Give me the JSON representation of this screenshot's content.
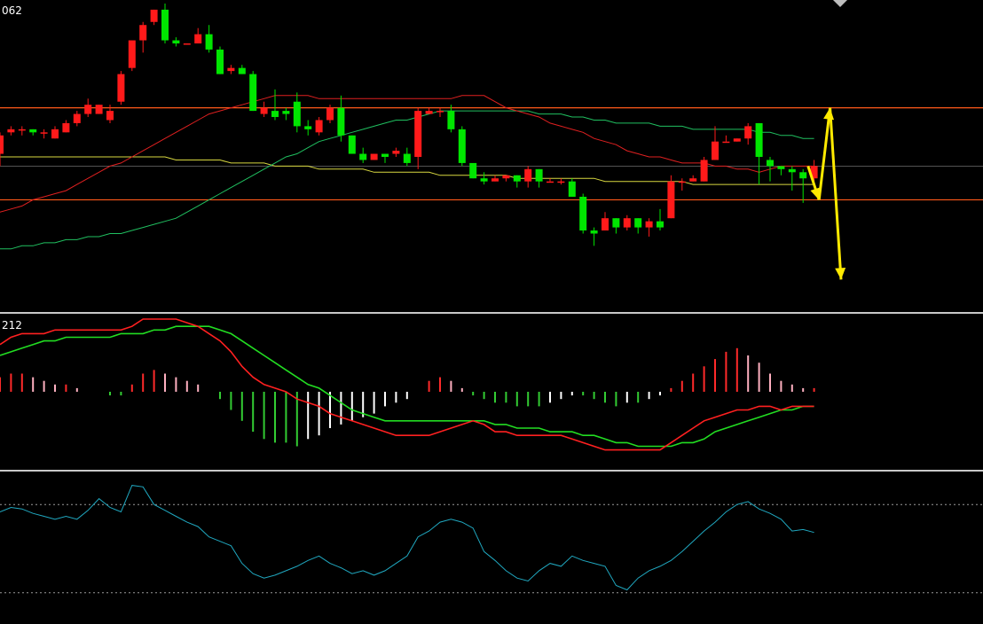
{
  "colors": {
    "background": "#000000",
    "bull": "#ff1a1a",
    "bear": "#00e600",
    "ma_fast": "#e02020",
    "ma_mid": "#20c060",
    "ma_slow": "#d8d840",
    "hline": "#ff5a1a",
    "arrow": "#ffea00",
    "separator": "#c8c8c8",
    "dif": "#ff2020",
    "dea": "#22dd22",
    "hist_pos_strong": "#ff2a2a",
    "hist_pos_weak": "#ffb0c0",
    "hist_neg_strong": "#33cc33",
    "hist_neg_weak": "#ffffff",
    "osc": "#20a8c0",
    "osc_level": "#9a9a9a"
  },
  "panels": {
    "price_label": "062",
    "macd_label": "212"
  },
  "chart_data": [
    {
      "type": "candlestick",
      "panel": "price",
      "ylim": [
        0,
        100
      ],
      "x": [
        0,
        1,
        2,
        3,
        4,
        5,
        6,
        7,
        8,
        9,
        10,
        11,
        12,
        13,
        14,
        15,
        16,
        17,
        18,
        19,
        20,
        21,
        22,
        23,
        24,
        25,
        26,
        27,
        28,
        29,
        30,
        31,
        32,
        33,
        34,
        35,
        36,
        37,
        38,
        39,
        40,
        41,
        42,
        43,
        44,
        45,
        46,
        47,
        48,
        49,
        50,
        51,
        52,
        53,
        54,
        55,
        56,
        57,
        58,
        59,
        60,
        61,
        62,
        63,
        64,
        65,
        66,
        67,
        68,
        69,
        70,
        71,
        72,
        73,
        74
      ],
      "ohlc": [
        [
          51,
          57,
          47,
          58
        ],
        [
          58,
          59,
          57,
          60
        ],
        [
          59,
          59,
          57,
          60
        ],
        [
          59,
          58,
          57,
          59
        ],
        [
          58,
          58,
          56,
          59
        ],
        [
          56,
          59,
          56,
          60
        ],
        [
          58,
          61,
          58,
          62
        ],
        [
          61,
          64,
          60,
          65
        ],
        [
          64,
          67,
          63,
          69
        ],
        [
          64,
          67,
          64,
          67
        ],
        [
          62,
          65,
          61,
          67
        ],
        [
          68,
          77,
          67,
          78
        ],
        [
          79,
          88,
          78,
          88
        ],
        [
          88,
          93,
          84,
          94
        ],
        [
          94,
          98,
          93,
          98
        ],
        [
          98,
          88,
          87,
          100
        ],
        [
          88,
          87,
          86,
          89
        ],
        [
          87,
          87,
          87,
          87
        ],
        [
          87,
          90,
          87,
          92
        ],
        [
          90,
          85,
          84,
          93
        ],
        [
          85,
          77,
          77,
          86
        ],
        [
          78,
          79,
          77,
          80
        ],
        [
          79,
          77,
          77,
          80
        ],
        [
          77,
          65,
          65,
          78
        ],
        [
          64,
          66,
          63,
          68
        ],
        [
          65,
          63,
          62,
          72
        ],
        [
          65,
          64,
          62,
          66
        ],
        [
          68,
          60,
          58,
          71
        ],
        [
          60,
          59,
          57,
          62
        ],
        [
          58,
          62,
          57,
          63
        ],
        [
          62,
          66,
          61,
          67
        ],
        [
          66,
          57,
          55,
          70
        ],
        [
          57,
          51,
          51,
          57
        ],
        [
          51,
          49,
          48,
          53
        ],
        [
          49,
          51,
          49,
          51
        ],
        [
          51,
          50,
          48,
          51
        ],
        [
          51,
          52,
          50,
          53
        ],
        [
          51,
          48,
          47,
          53
        ],
        [
          50,
          65,
          46,
          66
        ],
        [
          64,
          65,
          64,
          66
        ],
        [
          65,
          65,
          63,
          66
        ],
        [
          65,
          59,
          58,
          67
        ],
        [
          59,
          48,
          47,
          60
        ],
        [
          48,
          43,
          43,
          47
        ],
        [
          43,
          42,
          41,
          45
        ],
        [
          42,
          43,
          42,
          44
        ],
        [
          43,
          44,
          42,
          44
        ],
        [
          44,
          42,
          40,
          44
        ],
        [
          42,
          46,
          40,
          47
        ],
        [
          46,
          42,
          40,
          46
        ],
        [
          42,
          42,
          42,
          43
        ],
        [
          42,
          42,
          41,
          43
        ],
        [
          42,
          37,
          37,
          43
        ],
        [
          37,
          26,
          25,
          38
        ],
        [
          26,
          25,
          21,
          27
        ],
        [
          26,
          30,
          26,
          32
        ],
        [
          30,
          27,
          25,
          30
        ],
        [
          27,
          30,
          26,
          31
        ],
        [
          30,
          27,
          25,
          30
        ],
        [
          27,
          29,
          24,
          30
        ],
        [
          29,
          27,
          26,
          33
        ],
        [
          30,
          42,
          30,
          44
        ],
        [
          42,
          42,
          39,
          43
        ],
        [
          42,
          43,
          42,
          44
        ],
        [
          42,
          49,
          42,
          50
        ],
        [
          49,
          55,
          49,
          60
        ],
        [
          55,
          55,
          55,
          57
        ],
        [
          55,
          56,
          55,
          56
        ],
        [
          56,
          60,
          54,
          61
        ],
        [
          61,
          50,
          41,
          61
        ],
        [
          49,
          47,
          42,
          50
        ],
        [
          47,
          46,
          44,
          47
        ],
        [
          46,
          45,
          39,
          47
        ],
        [
          45,
          43,
          35,
          46
        ],
        [
          43,
          47,
          41,
          49
        ]
      ],
      "ma_fast": [
        32,
        33,
        34,
        36,
        37,
        38,
        39,
        41,
        43,
        45,
        47,
        48,
        50,
        52,
        54,
        56,
        58,
        60,
        62,
        64,
        65,
        66,
        67,
        68,
        69,
        70,
        70,
        70,
        70,
        69,
        69,
        69,
        69,
        69,
        69,
        69,
        69,
        69,
        69,
        69,
        69,
        69,
        70,
        70,
        70,
        68,
        66,
        65,
        64,
        63,
        61,
        60,
        59,
        58,
        56,
        55,
        54,
        52,
        51,
        50,
        50,
        49,
        48,
        48,
        48,
        47,
        47,
        46,
        46,
        45,
        46,
        47,
        47,
        47,
        47
      ],
      "ma_mid": [
        20,
        20,
        21,
        21,
        22,
        22,
        23,
        23,
        24,
        24,
        25,
        25,
        26,
        27,
        28,
        29,
        30,
        32,
        34,
        36,
        38,
        40,
        42,
        44,
        46,
        48,
        50,
        51,
        53,
        55,
        56,
        57,
        58,
        59,
        60,
        61,
        62,
        62,
        63,
        64,
        65,
        65,
        65,
        65,
        65,
        65,
        65,
        65,
        65,
        64,
        64,
        64,
        63,
        63,
        62,
        62,
        61,
        61,
        61,
        61,
        60,
        60,
        60,
        59,
        59,
        59,
        59,
        59,
        59,
        58,
        58,
        57,
        57,
        56,
        56
      ],
      "ma_slow": [
        50,
        50,
        50,
        50,
        50,
        50,
        50,
        50,
        50,
        50,
        50,
        50,
        50,
        50,
        50,
        50,
        49,
        49,
        49,
        49,
        49,
        48,
        48,
        48,
        48,
        47,
        47,
        47,
        47,
        46,
        46,
        46,
        46,
        46,
        45,
        45,
        45,
        45,
        45,
        45,
        44,
        44,
        44,
        44,
        44,
        44,
        44,
        43,
        43,
        43,
        43,
        43,
        43,
        43,
        43,
        42,
        42,
        42,
        42,
        42,
        42,
        42,
        42,
        41,
        41,
        41,
        41,
        41,
        41,
        41,
        41,
        41,
        41,
        41,
        41
      ],
      "hlines": [
        66,
        36,
        47
      ]
    },
    {
      "type": "macd",
      "panel": "macd",
      "ylim": [
        -20,
        20
      ],
      "dif": [
        13,
        15,
        16,
        16,
        16,
        17,
        17,
        17,
        17,
        17,
        17,
        17,
        18,
        20,
        20,
        20,
        20,
        19,
        18,
        16,
        14,
        11,
        7,
        4,
        2,
        1,
        0,
        -2,
        -3,
        -4,
        -6,
        -7,
        -8,
        -9,
        -10,
        -11,
        -12,
        -12,
        -12,
        -12,
        -11,
        -10,
        -9,
        -8,
        -9,
        -11,
        -11,
        -12,
        -12,
        -12,
        -12,
        -12,
        -13,
        -14,
        -15,
        -16,
        -16,
        -16,
        -16,
        -16,
        -16,
        -14,
        -12,
        -10,
        -8,
        -7,
        -6,
        -5,
        -5,
        -4,
        -4,
        -5,
        -4,
        -4,
        -4
      ],
      "dea": [
        10,
        11,
        12,
        13,
        14,
        14,
        15,
        15,
        15,
        15,
        15,
        16,
        16,
        16,
        17,
        17,
        18,
        18,
        18,
        18,
        17,
        16,
        14,
        12,
        10,
        8,
        6,
        4,
        2,
        1,
        -1,
        -3,
        -5,
        -6,
        -7,
        -8,
        -8,
        -8,
        -8,
        -8,
        -8,
        -8,
        -8,
        -8,
        -8,
        -9,
        -9,
        -10,
        -10,
        -10,
        -11,
        -11,
        -11,
        -12,
        -12,
        -13,
        -14,
        -14,
        -15,
        -15,
        -15,
        -15,
        -14,
        -14,
        -13,
        -11,
        -10,
        -9,
        -8,
        -7,
        -6,
        -5,
        -5,
        -4,
        -4
      ],
      "hist": [
        4,
        5,
        5,
        4,
        3,
        2,
        2,
        1,
        0,
        0,
        -1,
        -1,
        2,
        5,
        6,
        5,
        4,
        3,
        2,
        0,
        -2,
        -5,
        -8,
        -11,
        -13,
        -14,
        -14,
        -15,
        -13,
        -12,
        -10,
        -9,
        -8,
        -7,
        -6,
        -4,
        -3,
        -2,
        0,
        3,
        4,
        3,
        1,
        -1,
        -2,
        -3,
        -3,
        -4,
        -4,
        -4,
        -3,
        -2,
        -1,
        -1,
        -2,
        -3,
        -4,
        -3,
        -3,
        -2,
        -1,
        1,
        3,
        5,
        7,
        9,
        11,
        12,
        10,
        8,
        5,
        3,
        2,
        1,
        1
      ]
    },
    {
      "type": "line",
      "panel": "oscillator",
      "ylim": [
        0,
        100
      ],
      "levels": [
        80,
        20
      ],
      "values": [
        75,
        78,
        77,
        74,
        72,
        70,
        72,
        70,
        76,
        84,
        78,
        75,
        93,
        92,
        80,
        76,
        72,
        68,
        65,
        58,
        55,
        52,
        40,
        33,
        30,
        32,
        35,
        38,
        42,
        45,
        40,
        37,
        33,
        35,
        32,
        35,
        40,
        45,
        58,
        62,
        68,
        70,
        68,
        64,
        48,
        42,
        35,
        30,
        28,
        35,
        40,
        38,
        45,
        42,
        40,
        38,
        25,
        22,
        30,
        35,
        38,
        42,
        48,
        55,
        62,
        68,
        75,
        80,
        82,
        77,
        74,
        70,
        62,
        63,
        61
      ]
    }
  ],
  "annotations": {
    "arrows": [
      {
        "from": [
          72,
          47
        ],
        "to": [
          73,
          36
        ]
      },
      {
        "from": [
          73,
          36
        ],
        "to": [
          74,
          66
        ]
      },
      {
        "from": [
          74,
          66
        ],
        "to": [
          75,
          10
        ]
      }
    ]
  }
}
